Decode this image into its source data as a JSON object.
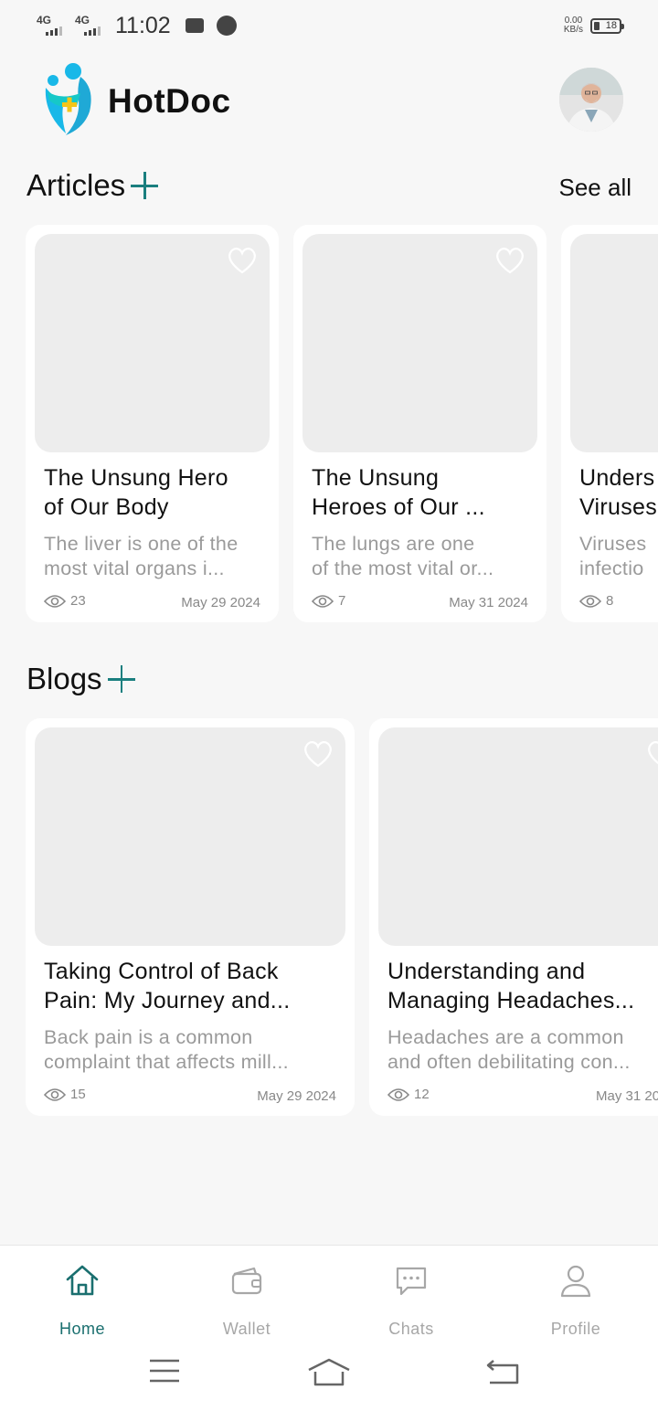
{
  "status_bar": {
    "network_1": "4G",
    "network_2": "4G",
    "time": "11:02",
    "speed_value": "0.00",
    "speed_unit": "KB/s",
    "battery": "18"
  },
  "header": {
    "app_name": "HotDoc"
  },
  "articles": {
    "section_title": "Articles",
    "see_all": "See all",
    "items": [
      {
        "title_line1": "The Unsung Hero",
        "title_line2": "of Our Body",
        "desc_line1": "The liver is one of the",
        "desc_line2": "most vital organs i...",
        "views": "23",
        "date": "May 29 2024"
      },
      {
        "title_line1": "The Unsung",
        "title_line2": "Heroes of Our ...",
        "desc_line1": "The lungs are one",
        "desc_line2": "of the most vital or...",
        "views": "7",
        "date": "May 31 2024"
      },
      {
        "title_line1": "Unders",
        "title_line2": "Viruses",
        "desc_line1": "Viruses",
        "desc_line2": "infectio",
        "views": "8",
        "date": ""
      }
    ]
  },
  "blogs": {
    "section_title": "Blogs",
    "items": [
      {
        "title_line1": "Taking Control of Back",
        "title_line2": "Pain: My Journey and...",
        "desc_line1": "Back pain is a common",
        "desc_line2": "complaint that affects mill...",
        "views": "15",
        "date": "May 29 2024"
      },
      {
        "title_line1": "Understanding and",
        "title_line2": "Managing Headaches...",
        "desc_line1": "Headaches are a common",
        "desc_line2": "and often debilitating con...",
        "views": "12",
        "date": "May 31 20"
      }
    ]
  },
  "bottom_nav": {
    "items": [
      {
        "label": "Home",
        "icon": "home-icon",
        "active": true
      },
      {
        "label": "Wallet",
        "icon": "wallet-icon",
        "active": false
      },
      {
        "label": "Chats",
        "icon": "chat-icon",
        "active": false
      },
      {
        "label": "Profile",
        "icon": "profile-icon",
        "active": false
      }
    ]
  },
  "colors": {
    "accent": "#1a7f7f",
    "background": "#f7f7f7",
    "card": "#ffffff",
    "placeholder": "#ededed",
    "muted_text": "#9a9a9a"
  }
}
